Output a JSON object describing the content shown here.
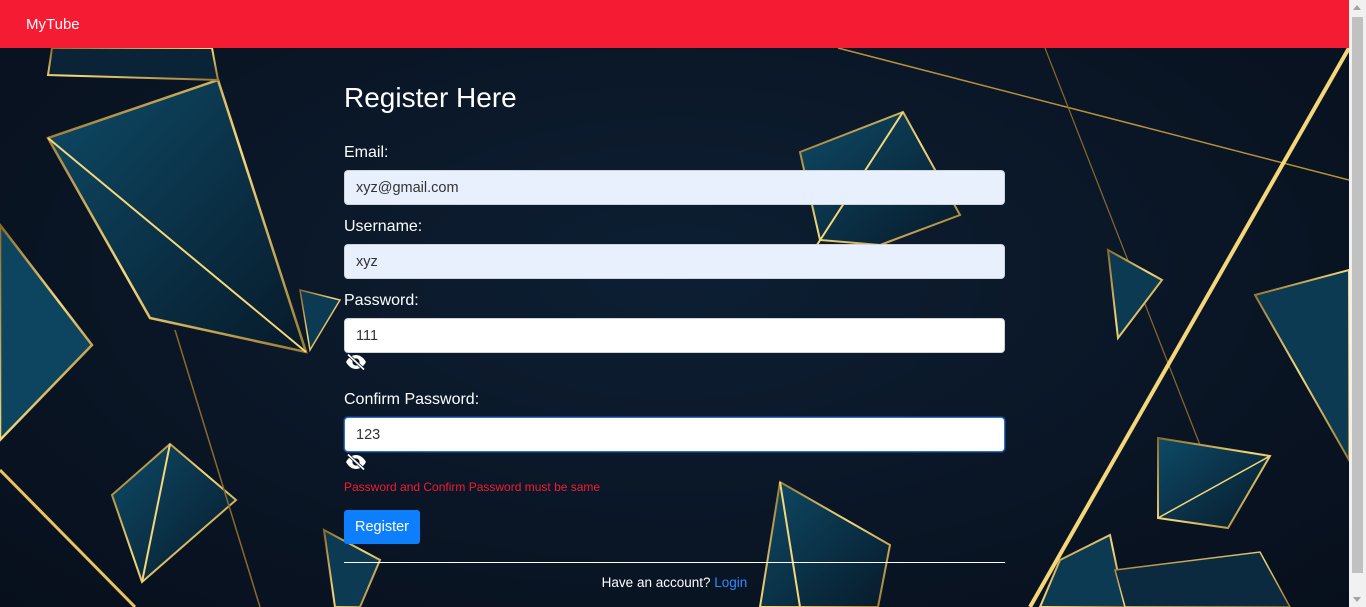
{
  "app": {
    "brand": "MyTube",
    "brand_color": "#f51b33"
  },
  "form": {
    "title": "Register Here",
    "email": {
      "label": "Email:",
      "value": "xyz@gmail.com"
    },
    "username": {
      "label": "Username:",
      "value": "xyz"
    },
    "password": {
      "label": "Password:",
      "value": "111",
      "visibility_icon": "eye-slash-icon"
    },
    "confirm_password": {
      "label": "Confirm Password:",
      "value": "123",
      "visibility_icon": "eye-slash-icon"
    },
    "error": "Password and Confirm Password must be same",
    "submit_label": "Register",
    "footer_text": "Have an account?",
    "login_label": "Login"
  },
  "colors": {
    "error": "#f51b33",
    "button": "#0d7ffc",
    "link": "#2f8cff",
    "background": "#0a1626",
    "accent_gold": "#e8c45a"
  }
}
